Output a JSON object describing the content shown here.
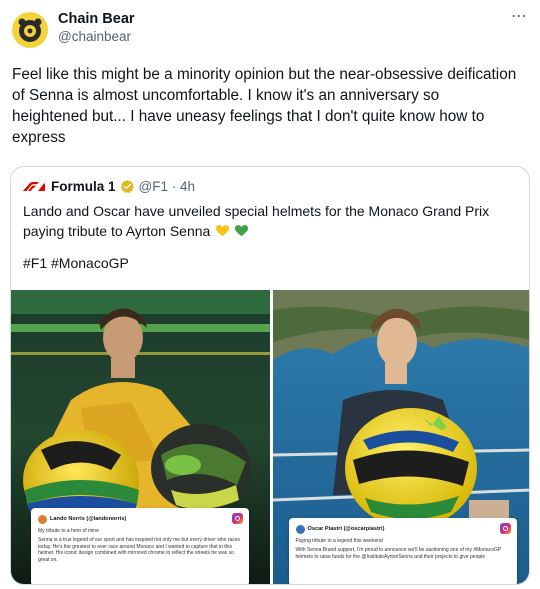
{
  "tweet": {
    "display_name": "Chain Bear",
    "handle": "@chainbear",
    "more_icon": "⋯",
    "text": "Feel like this might be a minority opinion but the near-obsessive deification of Senna is almost uncomfortable. I know it's an anniversary so heightened but... I have uneasy feelings that I don't quite know how to express"
  },
  "quoted": {
    "display_name": "Formula 1",
    "handle_time": "@F1 · 4h",
    "text": "Lando and Oscar have unveiled special helmets for the Monaco Grand Prix paying tribute to Ayrton Senna",
    "emoji": [
      "yellow-heart",
      "green-heart"
    ],
    "hashtags": "#F1 #MonacoGP"
  },
  "media": {
    "left_card": {
      "user": "Lando Norris (@landonorris)",
      "line1": "My tribute to a hero of mine",
      "line2": "Senna is a true legend of our sport and has inspired not only me but every driver who races today. He's the greatest to ever race around Monaco and I wanted to capture that in this helmet. His iconic design combined with mirrored chrome to reflect the streets he was so great on."
    },
    "right_card": {
      "user": "Oscar Piastri (@oscarpiastri)",
      "line1": "Paying tribute to a legend this weekend",
      "line2": "With Senna Brand support, I'm proud to announce we'll be auctioning one of my #MonacoGP helmets to raise funds for the @InstitutoAyrtonSenna and their projects to give people"
    }
  },
  "colors": {
    "brand_yellow": "#f2d33a",
    "f1_red": "#e10600",
    "verified_gold": "#e2b719",
    "muted": "#536471",
    "border": "#cfd9de"
  }
}
